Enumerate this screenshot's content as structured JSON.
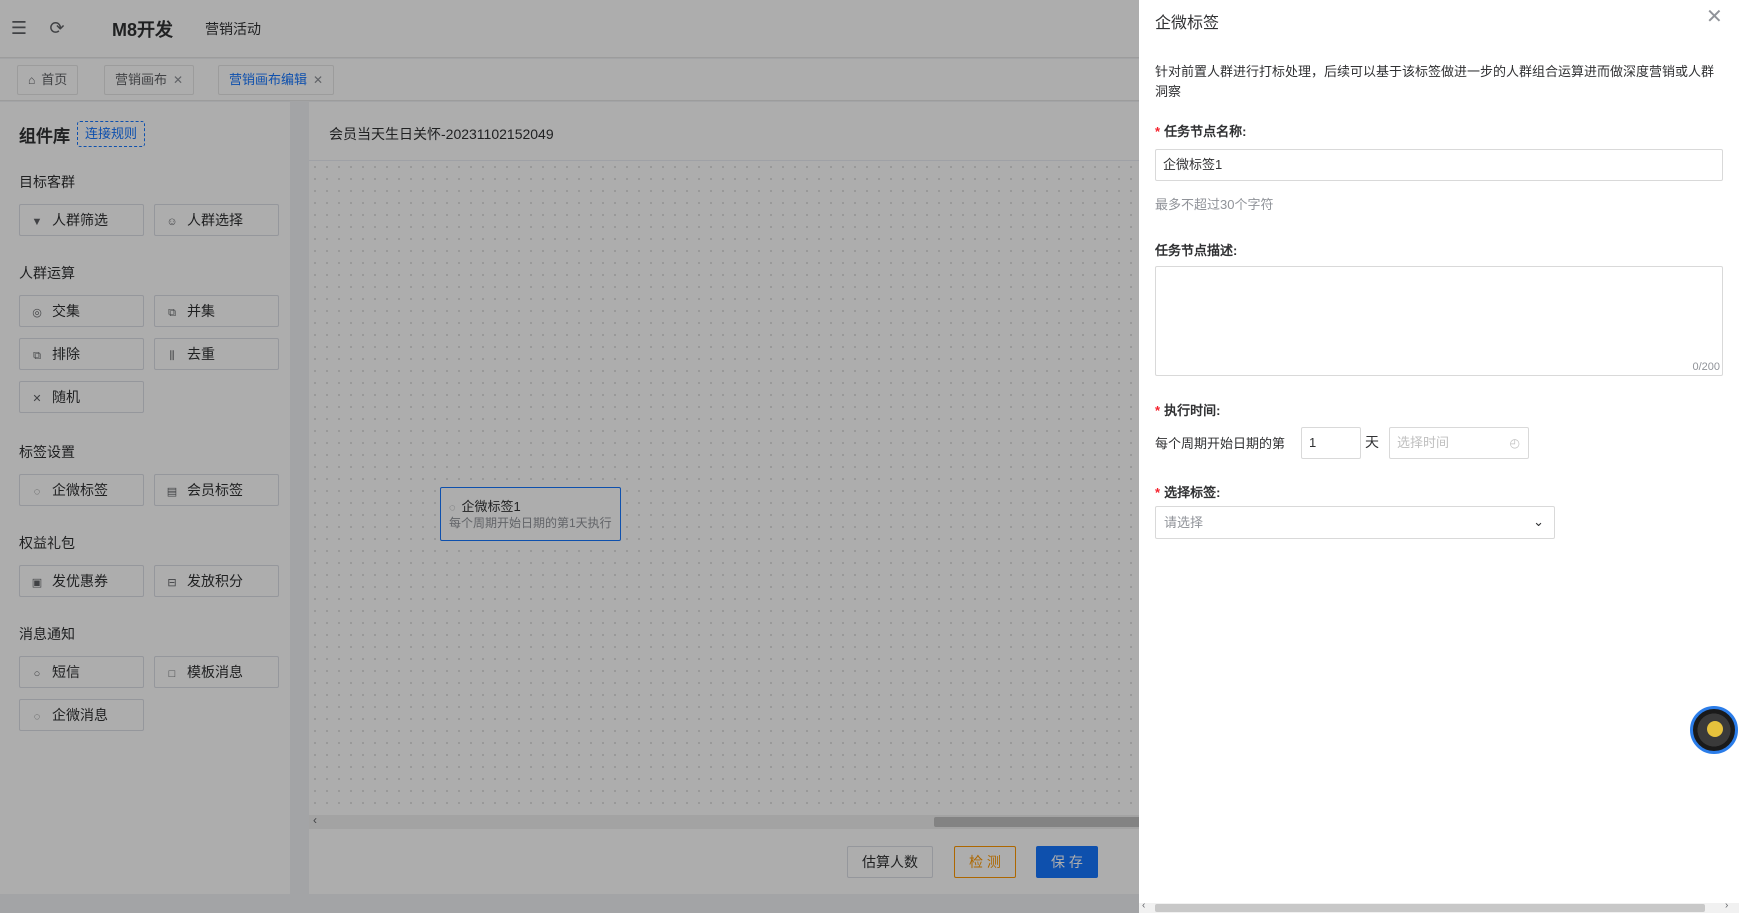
{
  "header": {
    "brand": "M8开发",
    "nav_item": "营销活动"
  },
  "tabs": [
    {
      "label": "首页"
    },
    {
      "label": "营销画布"
    },
    {
      "label": "营销画布编辑"
    }
  ],
  "sidebar": {
    "title": "组件库",
    "rule_link": "连接规则",
    "groups": [
      {
        "title": "目标客群",
        "items": [
          {
            "label": "人群筛选",
            "icon": "filter-icon"
          },
          {
            "label": "人群选择",
            "icon": "user-icon"
          }
        ]
      },
      {
        "title": "人群运算",
        "items": [
          {
            "label": "交集",
            "icon": "intersect-icon"
          },
          {
            "label": "并集",
            "icon": "union-icon"
          },
          {
            "label": "排除",
            "icon": "exclude-icon"
          },
          {
            "label": "去重",
            "icon": "dedupe-icon"
          },
          {
            "label": "随机",
            "icon": "shuffle-icon"
          }
        ]
      },
      {
        "title": "标签设置",
        "items": [
          {
            "label": "企微标签",
            "icon": "wecom-tag-icon"
          },
          {
            "label": "会员标签",
            "icon": "member-tag-icon"
          }
        ]
      },
      {
        "title": "权益礼包",
        "items": [
          {
            "label": "发优惠券",
            "icon": "coupon-icon"
          },
          {
            "label": "发放积分",
            "icon": "points-icon"
          }
        ]
      },
      {
        "title": "消息通知",
        "items": [
          {
            "label": "短信",
            "icon": "sms-icon"
          },
          {
            "label": "模板消息",
            "icon": "template-message-icon"
          },
          {
            "label": "企微消息",
            "icon": "wecom-message-icon"
          }
        ]
      }
    ]
  },
  "canvas": {
    "title": "会员当天生日关怀-20231102152049",
    "node": {
      "title": "企微标签1",
      "desc": "每个周期开始日期的第1天执行"
    }
  },
  "footer_buttons": {
    "estimate": "估算人数",
    "check": "检 测",
    "save": "保 存"
  },
  "drawer": {
    "title": "企微标签",
    "description": "针对前置人群进行打标处理，后续可以基于该标签做进一步的人群组合运算进而做深度营销或人群洞察",
    "required_mark": "*",
    "name_label": "任务节点名称:",
    "name_value": "企微标签1",
    "name_hint": "最多不超过30个字符",
    "desc_label": "任务节点描述:",
    "desc_counter": "0/200",
    "exec_label": "执行时间:",
    "exec_prefix": "每个周期开始日期的第",
    "exec_day_value": "1",
    "exec_unit": "天",
    "time_placeholder": "选择时间",
    "tag_label": "选择标签:",
    "tag_placeholder": "请选择"
  }
}
